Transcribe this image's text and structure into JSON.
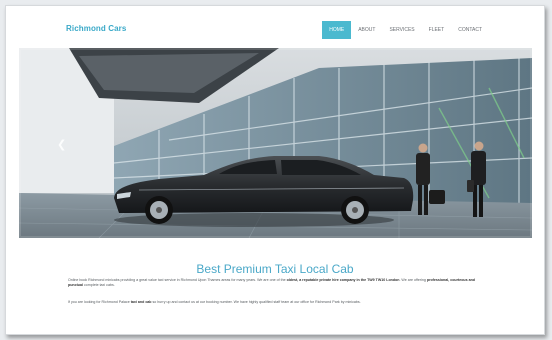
{
  "brand": {
    "name": "Richmond Cars",
    "accent": "#4bb9cf"
  },
  "nav": [
    {
      "label": "HOME",
      "active": true
    },
    {
      "label": "ABOUT",
      "active": false
    },
    {
      "label": "SERVICES",
      "active": false
    },
    {
      "label": "FLEET",
      "active": false
    },
    {
      "label": "CONTACT",
      "active": false
    }
  ],
  "slider": {
    "image": "black-sedan-with-chauffeurs-at-glass-terminal",
    "prev_icon": "chevron-left-icon",
    "slides_count": 2,
    "active_slide": 1
  },
  "main": {
    "title": "Best Premium Taxi Local Cab",
    "para1": {
      "t1": "Online book Richmond minicabs providing a great value taxi service in Richmond Upon Thames areas for many years. We are one of the ",
      "b1": "oldest, a reputable private hire company in the TW9 TW10 London",
      "t2": ". We are offering ",
      "b2": "professional, courteous and punctual",
      "t3": " complete taxi cabs."
    },
    "para2": {
      "t1": "If you are looking for Richmond Palace ",
      "b1": "taxi and cab",
      "t2": " so hurry up and contact us at our booking number. We have highly qualified staff team at our office for Richmond Park by minicabs."
    }
  }
}
